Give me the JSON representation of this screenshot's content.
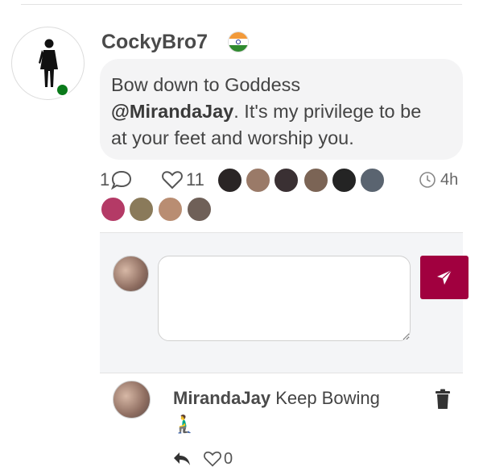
{
  "post": {
    "username": "CockyBro7",
    "flag_icon": "india-flag-icon",
    "text_line1": "Bow down to Goddess",
    "mention": "@MirandaJay",
    "text_rest1": ". It's my privilege to be",
    "text_line3": "at your feet and worship you.",
    "reply_count": "1",
    "like_count": "11",
    "time_ago": "4h"
  },
  "reactors": {
    "row1_colors": [
      "#2a2525",
      "#9a7a68",
      "#3a3033",
      "#7b6455",
      "#242424",
      "#5a6470"
    ],
    "row2_colors": [
      "#b43a66",
      "#8a7a5a",
      "#b98d72",
      "#6f6058"
    ]
  },
  "reply_box": {
    "placeholder": "",
    "send_icon": "paper-plane-icon",
    "send_color": "#a1003f"
  },
  "comment": {
    "author": "MirandaJay",
    "text": "Keep Bowing",
    "emoji": "🧎‍♂️",
    "like_count": "0"
  },
  "colors": {
    "online": "#0a7a1a",
    "accent": "#a1003f"
  }
}
